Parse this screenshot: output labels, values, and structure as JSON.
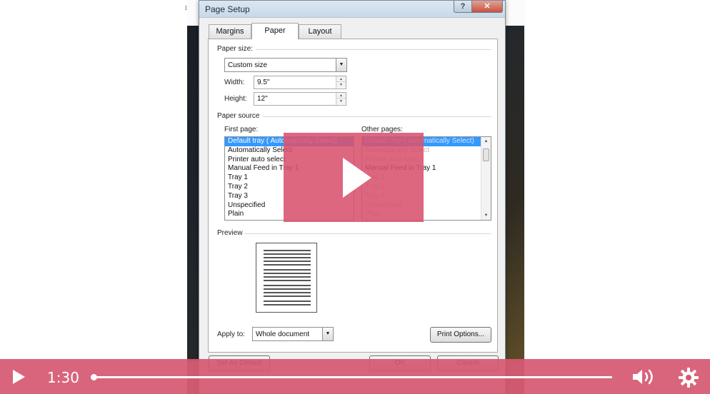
{
  "page": {
    "page_number": "1"
  },
  "dialog": {
    "title": "Page Setup",
    "help_glyph": "?",
    "close_glyph": "✕",
    "tabs": [
      {
        "label": "Margins",
        "active": false
      },
      {
        "label": "Paper",
        "active": true
      },
      {
        "label": "Layout",
        "active": false
      }
    ],
    "paper_size": {
      "section_label": "Paper size:",
      "selected": "Custom size",
      "width_label": "Width:",
      "width_value": "9.5\"",
      "height_label": "Height:",
      "height_value": "12\""
    },
    "paper_source": {
      "section_label": "Paper source",
      "first_page_label": "First page:",
      "other_pages_label": "Other pages:",
      "first_page_items": [
        "Default tray ( Automatically Select)",
        "Automatically Select",
        "Printer auto select",
        "Manual Feed in Tray 1",
        "Tray 1",
        "Tray 2",
        "Tray 3",
        "Unspecified",
        "Plain"
      ],
      "other_pages_items": [
        "Default tray ( Automatically Select)",
        "Automatically Select",
        "Printer auto select",
        "Manual Feed in Tray 1",
        "Tray 1",
        "Tray 2",
        "Tray 3",
        "Unspecified",
        "Plain"
      ],
      "selected_index": 0
    },
    "preview": {
      "section_label": "Preview"
    },
    "apply_to": {
      "label": "Apply to:",
      "selected": "Whole document"
    },
    "buttons": {
      "print_options": "Print Options...",
      "set_as_default": "Set As Default",
      "ok": "OK",
      "cancel": "Cancel"
    }
  },
  "player": {
    "time": "1:30",
    "progress": 0.0,
    "accent_color": "#d6586e"
  }
}
